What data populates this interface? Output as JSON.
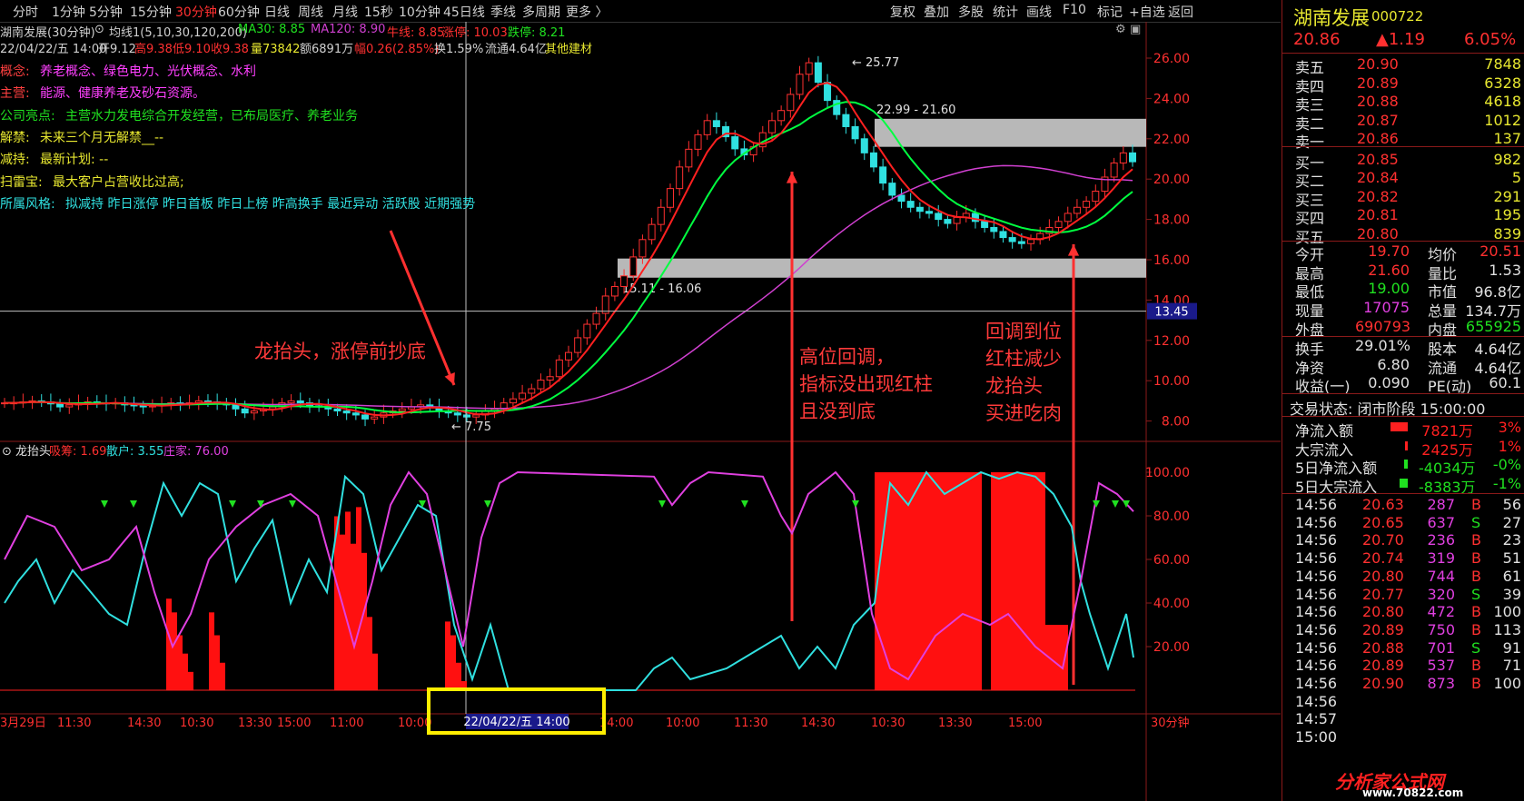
{
  "toolbar": {
    "periods": [
      "分时",
      "1分钟",
      "5分钟",
      "15分钟",
      "30分钟",
      "60分钟",
      "日线",
      "周线",
      "月线",
      "15秒",
      "10分钟",
      "45日线",
      "季线",
      "多周期",
      "更多 〉"
    ],
    "active_period": "30分钟",
    "tools": [
      "复权",
      "叠加",
      "多股",
      "统计",
      "画线",
      "F10",
      "标记",
      "+自选",
      "返回"
    ]
  },
  "chart_header": {
    "title": "湖南发展(30分钟)",
    "ma_name": "均线1(5,10,30,120,200)",
    "ma30": "MA30: 8.85",
    "ma120": "MA120: 8.90",
    "niu": "牛线: 8.85",
    "zhangwu": "涨停: 10.03",
    "diewu": "跌停: 8.21"
  },
  "bar_info": {
    "date": "22/04/22/五 14:00",
    "open": "开9.12",
    "high": "高9.38",
    "low": "低9.10",
    "close": "收9.38",
    "volume": "量73842",
    "amount": "额6891万",
    "amplitude": "幅0.26(2.85%)",
    "turnover": "换1.59%",
    "float": "流通4.64亿",
    "sector": "其他建材"
  },
  "overlay_lines": [
    {
      "label": "概念:",
      "text": "养老概念、绿色电力、光伏概念、水利"
    },
    {
      "label": "主营:",
      "text": "能源、健康养老及砂石资源。"
    },
    {
      "label": "公司亮点:",
      "text": "主营水力发电综合开发经营，已布局医疗、养老业务"
    },
    {
      "label": "解禁:",
      "text": "未来三个月无解禁__--"
    },
    {
      "label": "减持:",
      "text": "最新计划: --"
    },
    {
      "label": "扫雷宝:",
      "text": "最大客户占营收比过高;"
    },
    {
      "label": "所属风格:",
      "text": "拟减持 昨日涨停 昨日首板 昨日上榜 昨高换手 最近异动 活跃股 近期强势"
    }
  ],
  "price_labels": {
    "high_mark": "25.77",
    "low_mark": "7.75",
    "resist_range": "22.99 - 21.60",
    "support_range": "15.11 - 16.06",
    "cursor_price": "13.45"
  },
  "annotations": {
    "a1": "龙抬头，涨停前抄底",
    "a2": [
      "高位回调，",
      "指标没出现红柱",
      "且没到底"
    ],
    "a3": [
      "回调到位",
      "红柱减少",
      "龙抬头",
      "买进吃肉"
    ]
  },
  "indicator_header": {
    "name": "龙抬头",
    "xichou": "吸筹: 1.69",
    "sanhu": "散户: 3.55",
    "zhuangjia": "庄家: 76.00"
  },
  "time_axis": {
    "labels": [
      "3月29日",
      "11:30",
      "14:30",
      "10:30",
      "13:30",
      "15:00",
      "11:00",
      "10:00",
      "14:00",
      "10:00",
      "11:30",
      "14:30",
      "10:30",
      "13:30",
      "15:00"
    ],
    "cursor_label": "22/04/22/五 14:00",
    "period_label": "30分钟"
  },
  "chart_data": {
    "type": "candlestick",
    "title": "湖南发展(30分钟)",
    "price_axis": {
      "ticks": [
        26.0,
        24.0,
        22.0,
        20.0,
        18.0,
        16.0,
        14.0,
        12.0,
        10.0,
        8.0
      ],
      "range": [
        7.0,
        27.0
      ]
    },
    "indicator_axis": {
      "ticks": [
        100.0,
        80.0,
        60.0,
        40.0,
        20.0
      ],
      "range": [
        0,
        110
      ]
    },
    "price_close_approx": [
      8.9,
      8.9,
      8.95,
      9.0,
      8.95,
      8.85,
      8.7,
      8.8,
      8.9,
      8.95,
      8.9,
      8.85,
      8.9,
      8.8,
      8.75,
      8.7,
      8.75,
      8.8,
      8.9,
      8.85,
      8.9,
      9.0,
      8.95,
      8.9,
      8.8,
      8.6,
      8.4,
      8.5,
      8.6,
      8.7,
      8.9,
      9.0,
      8.9,
      8.75,
      8.7,
      8.6,
      8.5,
      8.4,
      8.3,
      8.1,
      8.2,
      8.4,
      8.5,
      8.6,
      8.7,
      8.8,
      8.7,
      8.5,
      8.4,
      8.3,
      8.2,
      8.3,
      8.5,
      8.6,
      8.9,
      9.1,
      9.38,
      9.6,
      10.03,
      10.2,
      11.03,
      11.4,
      12.13,
      12.8,
      13.34,
      14.2,
      14.67,
      15.2,
      16.14,
      17.0,
      17.75,
      18.6,
      19.53,
      20.6,
      21.48,
      22.2,
      22.9,
      22.6,
      22.1,
      21.5,
      21.2,
      21.6,
      22.3,
      22.9,
      23.4,
      24.2,
      25.2,
      25.77,
      24.8,
      23.9,
      23.2,
      22.6,
      22.0,
      21.3,
      20.6,
      19.8,
      19.2,
      18.9,
      18.6,
      18.4,
      18.3,
      18.0,
      17.8,
      18.1,
      18.3,
      17.9,
      17.6,
      17.4,
      17.1,
      16.9,
      16.8,
      17.0,
      17.3,
      17.6,
      17.9,
      18.3,
      18.6,
      18.9,
      19.4,
      20.1,
      20.8,
      21.3,
      20.86
    ],
    "ma_series": [
      {
        "name": "MA30",
        "color": "#00ff40"
      },
      {
        "name": "MA120",
        "color": "#d040d0"
      }
    ],
    "indicator_series": [
      {
        "name": "吸筹",
        "color": "#ff2020"
      },
      {
        "name": "散户",
        "color": "#30e0e0"
      },
      {
        "name": "庄家",
        "color": "#e040e0"
      }
    ]
  },
  "stock": {
    "name": "湖南发展",
    "code": "000722",
    "price": "20.86",
    "change": "▲1.19",
    "pct": "6.05%"
  },
  "order_book": {
    "asks": [
      {
        "label": "卖五",
        "price": "20.90",
        "vol": "7848"
      },
      {
        "label": "卖四",
        "price": "20.89",
        "vol": "6328"
      },
      {
        "label": "卖三",
        "price": "20.88",
        "vol": "4618"
      },
      {
        "label": "卖二",
        "price": "20.87",
        "vol": "1012"
      },
      {
        "label": "卖一",
        "price": "20.86",
        "vol": "137"
      }
    ],
    "bids": [
      {
        "label": "买一",
        "price": "20.85",
        "vol": "982"
      },
      {
        "label": "买二",
        "price": "20.84",
        "vol": "5"
      },
      {
        "label": "买三",
        "price": "20.82",
        "vol": "291"
      },
      {
        "label": "买四",
        "price": "20.81",
        "vol": "195"
      },
      {
        "label": "买五",
        "price": "20.80",
        "vol": "839"
      }
    ]
  },
  "stats": [
    {
      "k1": "今开",
      "v1": "19.70",
      "k2": "均价",
      "v2": "20.51"
    },
    {
      "k1": "最高",
      "v1": "21.60",
      "k2": "量比",
      "v2": "1.53"
    },
    {
      "k1": "最低",
      "v1": "19.00",
      "k2": "市值",
      "v2": "96.8亿"
    },
    {
      "k1": "现量",
      "v1": "17075",
      "k2": "总量",
      "v2": "134.7万"
    },
    {
      "k1": "外盘",
      "v1": "690793",
      "k2": "内盘",
      "v2": "655925"
    }
  ],
  "stats2": [
    {
      "k1": "换手",
      "v1": "29.01%",
      "k2": "股本",
      "v2": "4.64亿"
    },
    {
      "k1": "净资",
      "v1": "6.80",
      "k2": "流通",
      "v2": "4.64亿"
    },
    {
      "k1": "收益(一)",
      "v1": "0.090",
      "k2": "PE(动)",
      "v2": "60.1"
    }
  ],
  "trade_status": "交易状态: 闭市阶段 15:00:00",
  "flows": [
    {
      "label": "净流入额",
      "value": "7821万",
      "pct": "3%",
      "color": "#ff2020",
      "frac": 0.95
    },
    {
      "label": "大宗流入",
      "value": "2425万",
      "pct": "1%",
      "color": "#ff2020",
      "frac": 0.15
    },
    {
      "label": "5日净流入额",
      "value": "-4034万",
      "pct": "-0%",
      "color": "#20e020",
      "frac": 0.2
    },
    {
      "label": "5日大宗流入",
      "value": "-8383万",
      "pct": "-1%",
      "color": "#20e020",
      "frac": 0.45
    }
  ],
  "ticks": [
    {
      "time": "14:56",
      "price": "20.63",
      "vol": "287",
      "side": "B",
      "extra": "56"
    },
    {
      "time": "14:56",
      "price": "20.65",
      "vol": "637",
      "side": "S",
      "extra": "27"
    },
    {
      "time": "14:56",
      "price": "20.70",
      "vol": "236",
      "side": "B",
      "extra": "23"
    },
    {
      "time": "14:56",
      "price": "20.74",
      "vol": "319",
      "side": "B",
      "extra": "51"
    },
    {
      "time": "14:56",
      "price": "20.80",
      "vol": "744",
      "side": "B",
      "extra": "61"
    },
    {
      "time": "14:56",
      "price": "20.77",
      "vol": "320",
      "side": "S",
      "extra": "39"
    },
    {
      "time": "14:56",
      "price": "20.80",
      "vol": "472",
      "side": "B",
      "extra": "100"
    },
    {
      "time": "14:56",
      "price": "20.89",
      "vol": "750",
      "side": "B",
      "extra": "113"
    },
    {
      "time": "14:56",
      "price": "20.88",
      "vol": "701",
      "side": "S",
      "extra": "91"
    },
    {
      "time": "14:56",
      "price": "20.89",
      "vol": "537",
      "side": "B",
      "extra": "71"
    },
    {
      "time": "14:56",
      "price": "20.90",
      "vol": "873",
      "side": "B",
      "extra": "100"
    },
    {
      "time": "14:56",
      "price": "",
      "vol": "",
      "side": "",
      "extra": ""
    },
    {
      "time": "14:57",
      "price": "",
      "vol": "",
      "side": "",
      "extra": ""
    },
    {
      "time": "15:00",
      "price": "",
      "vol": "",
      "side": "",
      "extra": ""
    }
  ],
  "watermark": {
    "name": "分析家公式网",
    "url": "www.70822.com"
  }
}
